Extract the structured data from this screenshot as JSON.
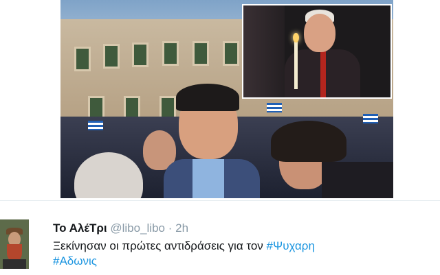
{
  "tweet": {
    "display_name": "Το ΑλέΤρι",
    "handle": "@libo_libo",
    "separator": "·",
    "time": "2h",
    "text": "Ξεκίνησαν οι πρώτες αντιδράσεις για τον ",
    "hashtags": [
      "#Ψυχαρη",
      "#Αδωνις"
    ]
  },
  "colors": {
    "hashtag": "#1b95e0",
    "muted": "#8899a6",
    "text": "#14171a"
  }
}
